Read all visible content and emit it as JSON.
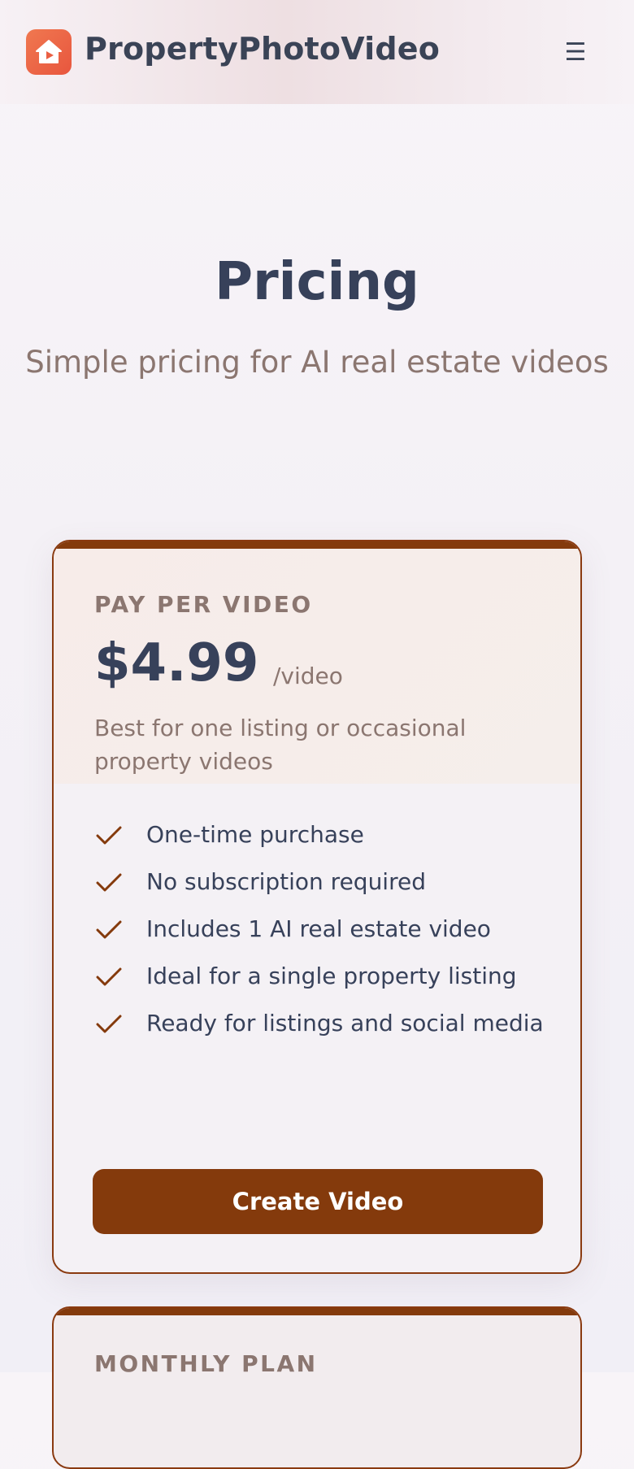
{
  "header": {
    "brand_name": "PropertyPhotoVideo",
    "logo_icon": "house-play-icon",
    "menu_icon": "hamburger-menu-icon",
    "menu_glyph": "☰"
  },
  "hero": {
    "title": "Pricing",
    "subtitle": "Simple pricing for AI real estate videos"
  },
  "plans": [
    {
      "label": "PAY PER VIDEO",
      "price": "$4.99",
      "unit": "/video",
      "description": "Best for one listing or occasional property videos",
      "features": [
        "One-time purchase",
        "No subscription required",
        "Includes 1 AI real estate video",
        "Ideal for a single property listing",
        "Ready for listings and social media"
      ],
      "cta_label": "Create Video"
    },
    {
      "label": "MONTHLY PLAN"
    }
  ],
  "colors": {
    "accent": "#843a0c",
    "logo": "#ea5f43",
    "heading": "#37415a",
    "muted": "#8b7670"
  }
}
